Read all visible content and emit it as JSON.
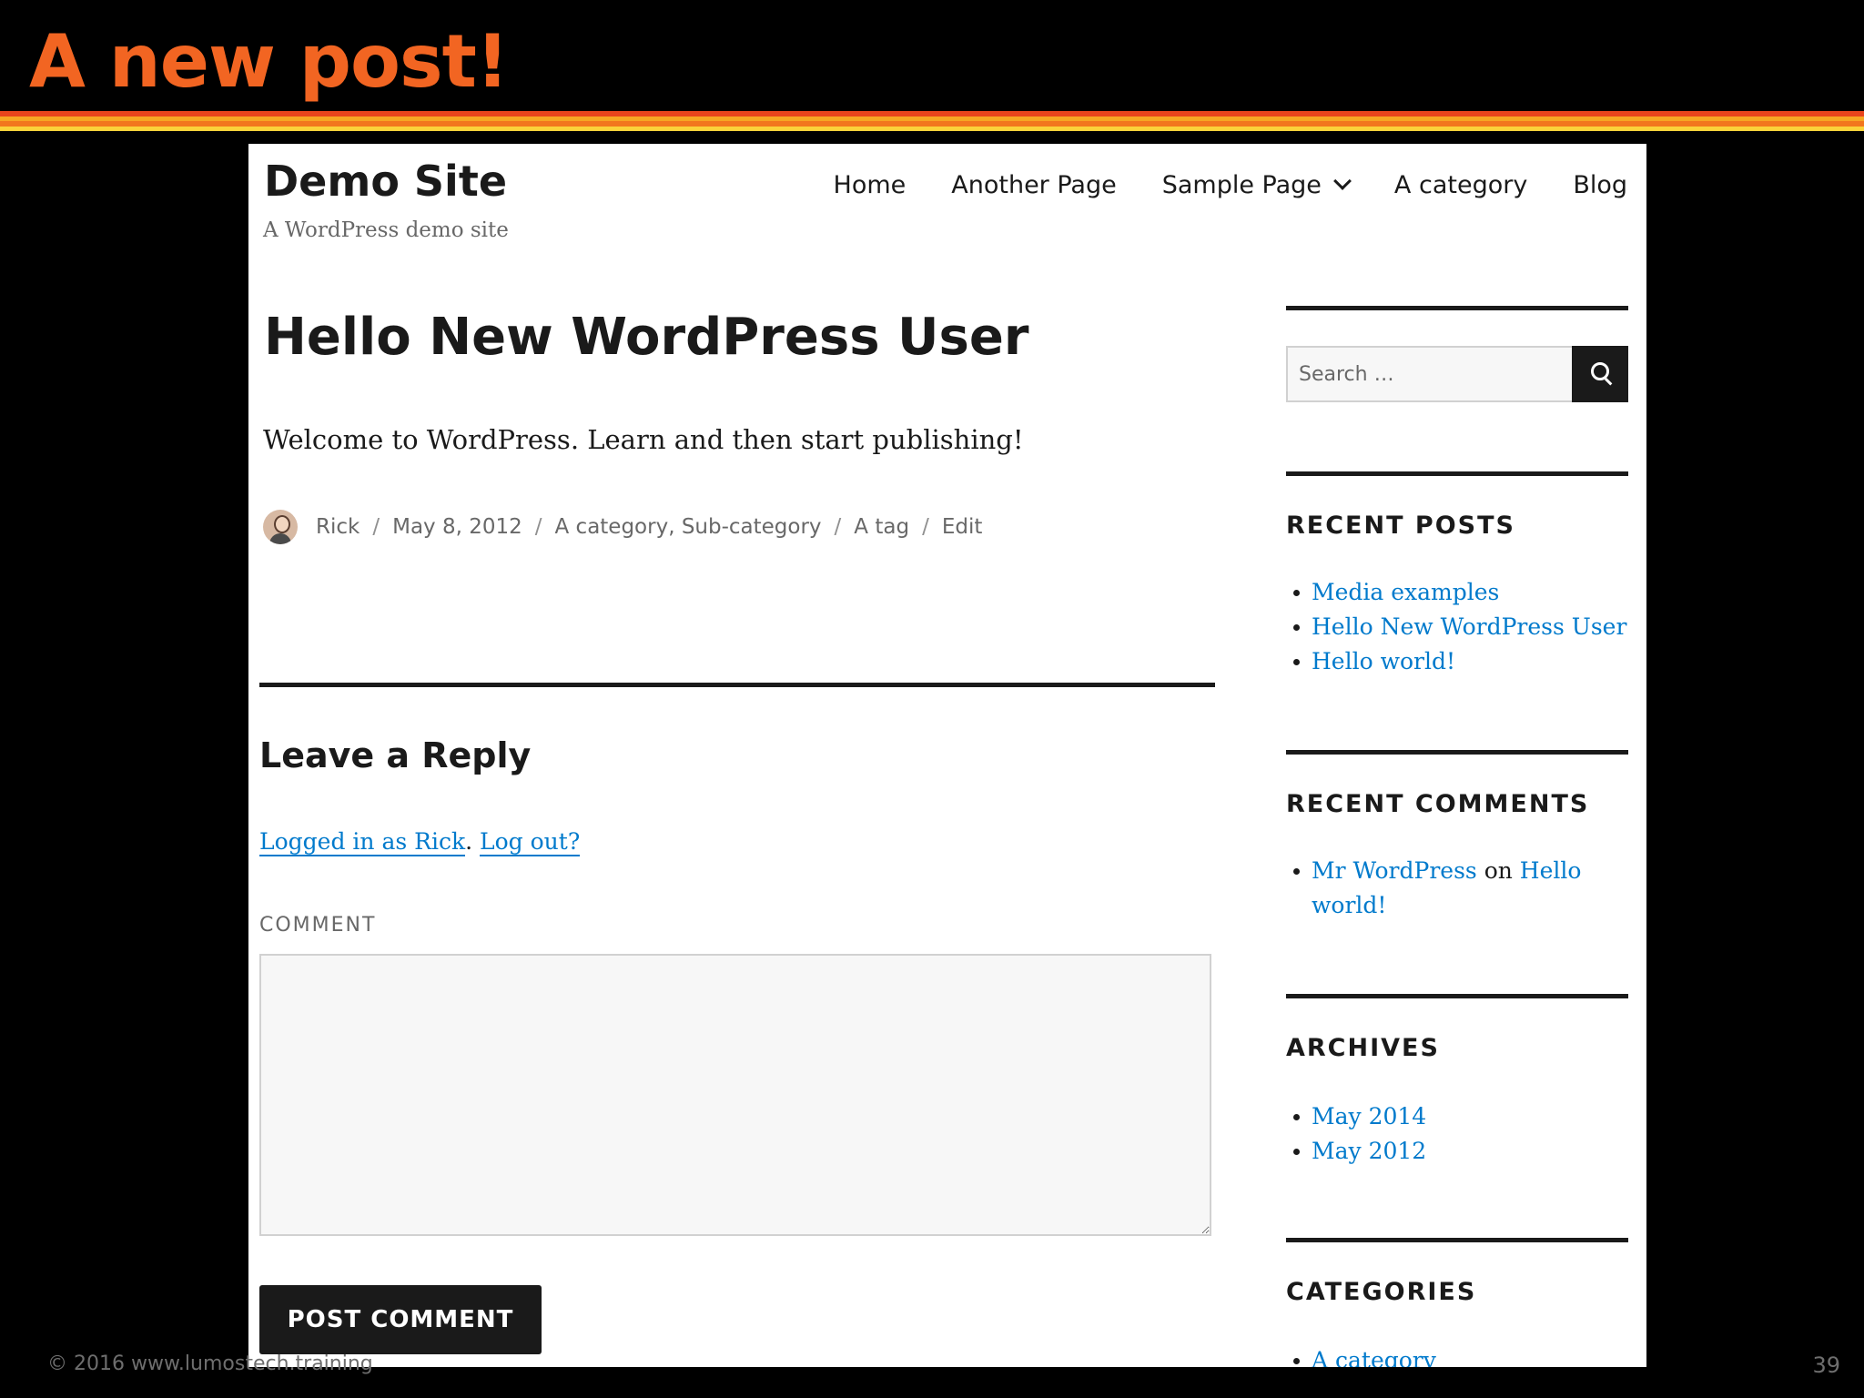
{
  "slide": {
    "title": "A new post!",
    "footer": "© 2016  www.lumostech.training",
    "page_number": "39",
    "stripe_colors": [
      "#e8441c",
      "#f6a623",
      "#f2761d",
      "#fbd23a"
    ],
    "title_color": "#f26522"
  },
  "site": {
    "title": "Demo Site",
    "tagline": "A WordPress demo site",
    "link_color": "#007acc"
  },
  "nav": {
    "items": [
      "Home",
      "Another Page",
      "Sample Page",
      "A category",
      "Blog"
    ]
  },
  "post": {
    "title": "Hello New WordPress User",
    "body": "Welcome to WordPress. Learn and then start publishing!",
    "meta": {
      "author": "Rick",
      "date": "May 8, 2012",
      "categories": "A category, Sub-category",
      "tag": "A tag",
      "edit": "Edit",
      "separator": "/"
    }
  },
  "reply": {
    "heading": "Leave a Reply",
    "logged_in": "Logged in as Rick",
    "period": ".",
    "logout": "Log out?",
    "comment_label": "COMMENT",
    "submit": "POST COMMENT"
  },
  "sidebar": {
    "search_placeholder": "Search …",
    "recent_posts": {
      "heading": "RECENT POSTS",
      "items": [
        "Media examples",
        "Hello New WordPress User",
        "Hello world!"
      ]
    },
    "recent_comments": {
      "heading": "RECENT COMMENTS",
      "author": "Mr WordPress",
      "on": "on",
      "post": "Hello world!"
    },
    "archives": {
      "heading": "ARCHIVES",
      "items": [
        "May 2014",
        "May 2012"
      ]
    },
    "categories": {
      "heading": "CATEGORIES",
      "items": [
        "A category"
      ]
    }
  }
}
